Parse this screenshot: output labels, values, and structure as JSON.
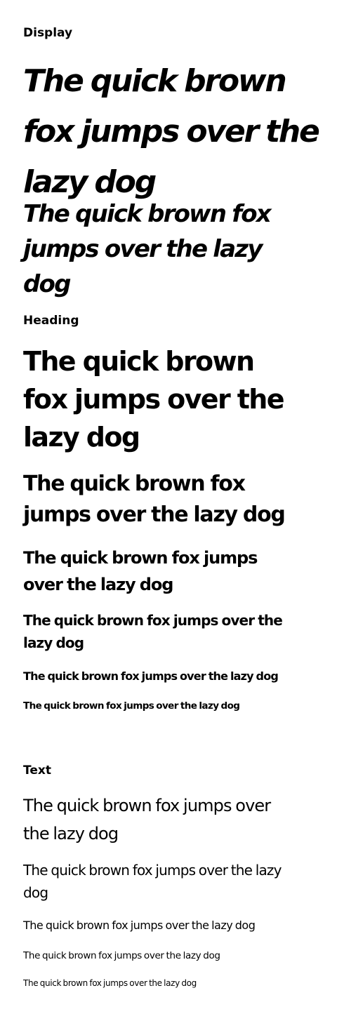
{
  "display": {
    "label": "Display",
    "samples": [
      "The quick brown fox jumps over the lazy dog",
      "The quick brown fox jumps over the lazy dog"
    ]
  },
  "heading": {
    "label": "Heading",
    "samples": [
      "The quick brown fox jumps over the lazy dog",
      "The quick brown fox jumps over the lazy dog",
      "The quick brown fox jumps over the lazy dog",
      "The quick brown fox jumps over the lazy dog",
      "The quick brown fox jumps over the lazy dog",
      "The quick brown fox jumps over the lazy dog"
    ]
  },
  "text": {
    "label": "Text",
    "samples": [
      "The quick brown fox jumps over the lazy dog",
      "The quick brown fox jumps over the lazy dog",
      "The quick brown fox jumps over the lazy dog",
      "The quick brown fox jumps over the lazy dog",
      "The quick brown fox jumps over the lazy dog"
    ]
  },
  "colors": {
    "background": "#ffffff",
    "text": "#000000"
  }
}
